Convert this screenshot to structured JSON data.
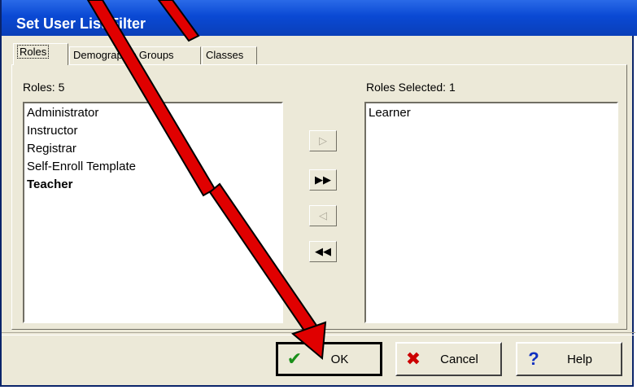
{
  "window": {
    "title": "Set User List Filter"
  },
  "tabs": [
    {
      "label": "Roles",
      "active": true
    },
    {
      "label": "Demographic Groups",
      "active": false
    },
    {
      "label": "Classes",
      "active": false
    }
  ],
  "roles": {
    "available_label": "Roles: 5",
    "selected_label": "Roles Selected: 1",
    "available": [
      "Administrator",
      "Instructor",
      "Registrar",
      "Self-Enroll Template",
      "Teacher"
    ],
    "selected": [
      "Learner"
    ]
  },
  "move_buttons": {
    "add_one": "▷",
    "add_all": "▶▶",
    "remove_one": "◁",
    "remove_all": "◀◀"
  },
  "buttons": {
    "ok": "OK",
    "cancel": "Cancel",
    "help": "Help"
  },
  "icons": {
    "ok": "checkmark-icon",
    "cancel": "x-icon",
    "help": "question-icon"
  },
  "colors": {
    "title_bar": "#0a49d4",
    "annotation_arrow": "#e00000",
    "ok_icon": "#1a8f1a",
    "cancel_icon": "#cc0000",
    "help_icon": "#1030c0"
  }
}
